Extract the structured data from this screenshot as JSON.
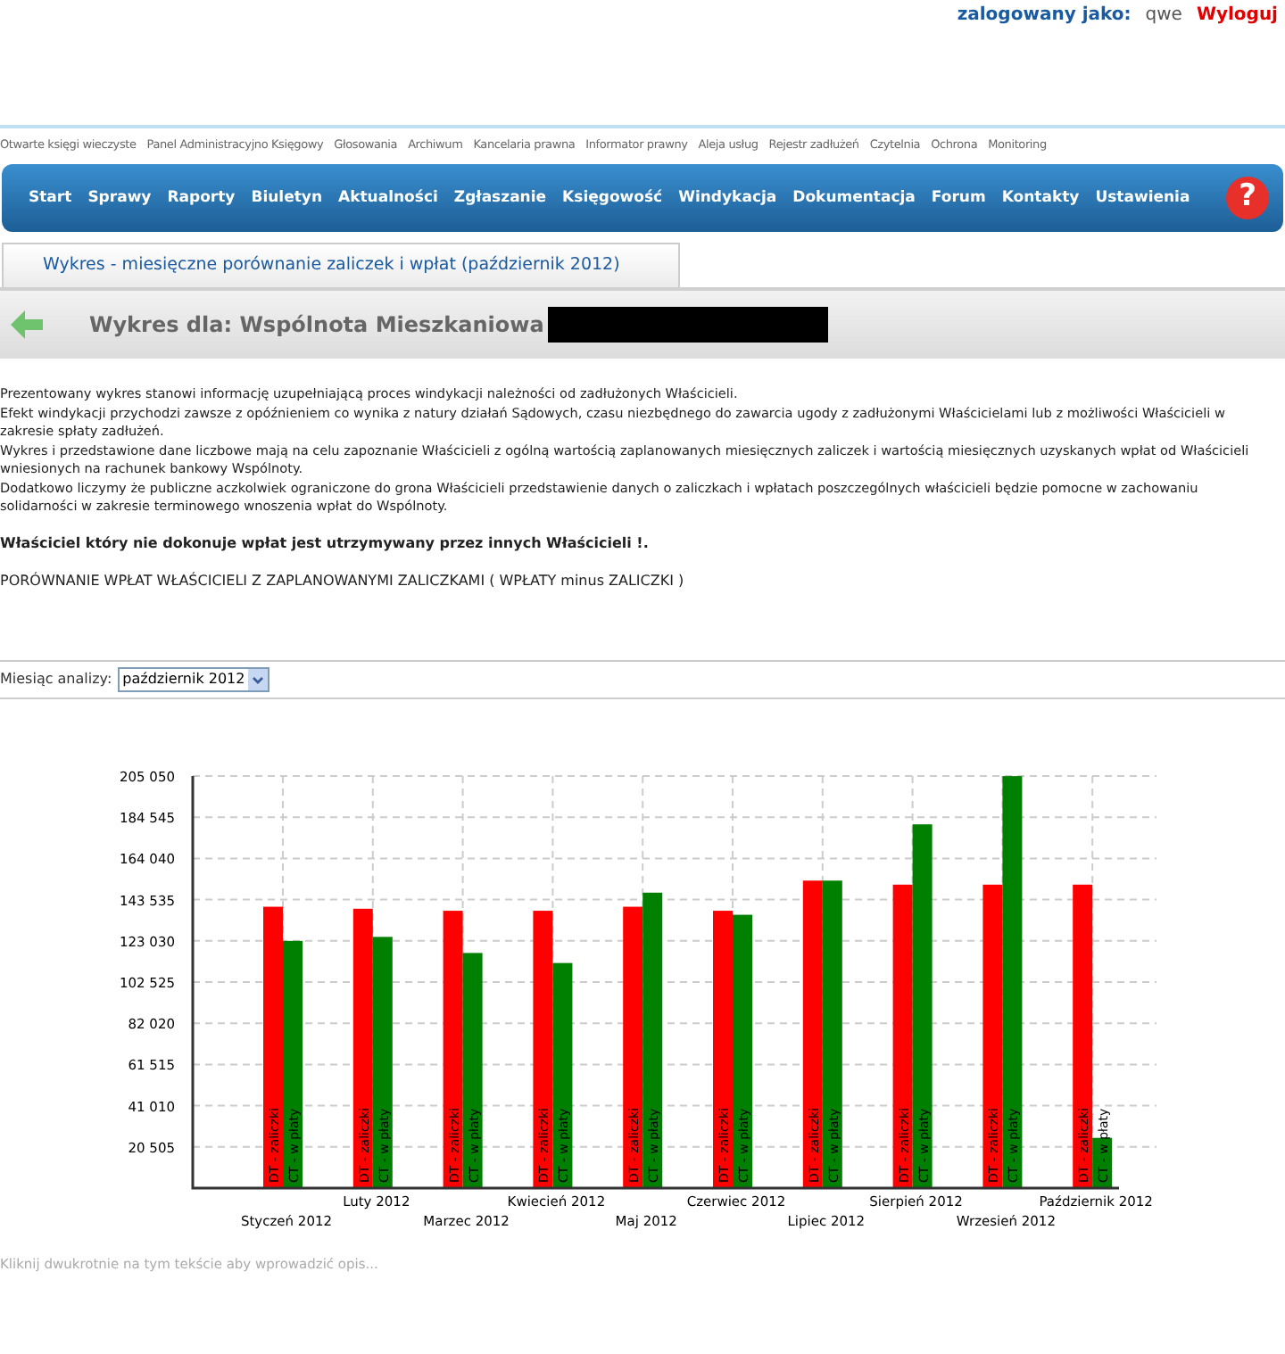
{
  "user_bar": {
    "label": "zalogowany jako:",
    "user": "qwe",
    "logout": "Wyloguj"
  },
  "top_links": [
    "Otwarte księgi wieczyste",
    "Panel Administracyjno Księgowy",
    "Głosowania",
    "Archiwum",
    "Kancelaria prawna",
    "Informator prawny",
    "Aleja usług",
    "Rejestr zadłużeń",
    "Czytelnia",
    "Ochrona",
    "Monitoring"
  ],
  "nav": [
    "Start",
    "Sprawy",
    "Raporty",
    "Biuletyn",
    "Aktualności",
    "Zgłaszanie",
    "Księgowość",
    "Windykacja",
    "Dokumentacja",
    "Forum",
    "Kontakty",
    "Ustawienia"
  ],
  "help_button": "?",
  "tab": {
    "label": "Wykres - miesięczne porównanie zaliczek i wpłat (październik 2012)",
    "selected": true
  },
  "header": {
    "title": "Wykres dla: Wspólnota Mieszkaniowa",
    "redacted": true
  },
  "intro": [
    "Prezentowany wykres stanowi informację uzupełniającą proces windykacji należności od zadłużonych Właścicieli.",
    "Efekt windykacji przychodzi zawsze z opóźnieniem co wynika z natury działań Sądowych, czasu niezbędnego do zawarcia ugody z zadłużonymi Właścicielami lub z możliwości Właścicieli w zakresie spłaty zadłużeń.",
    "Wykres i przedstawione dane liczbowe mają na celu zapoznanie Właścicieli z ogólną wartością zaplanowanych miesięcznych zaliczek i wartością miesięcznych uzyskanych wpłat od Właścicieli wniesionych na rachunek bankowy Wspólnoty.",
    "Dodatkowo liczymy że publiczne aczkolwiek ograniczone do grona Właścicieli przedstawienie danych o zaliczkach i wpłatach poszczególnych właścicieli będzie pomocne w zachowaniu solidarności w zakresie terminowego wnoszenia wpłat do Wspólnoty."
  ],
  "warning": "Właściciel który nie dokonuje wpłat jest utrzymywany przez innych Właścicieli !.",
  "section_title": "PORÓWNANIE WPŁAT WŁAŚCICIELI Z ZAPLANOWANYMI ZALICZKAMI ( WPŁATY minus ZALICZKI )",
  "month_select": {
    "label": "Miesiąc analizy:",
    "value": "październik 2012"
  },
  "chart_data": {
    "type": "bar",
    "categories": [
      "Styczeń 2012",
      "Luty 2012",
      "Marzec 2012",
      "Kwiecień 2012",
      "Maj 2012",
      "Czerwiec 2012",
      "Lipiec 2012",
      "Sierpień 2012",
      "Wrzesień 2012",
      "Październik 2012"
    ],
    "series": [
      {
        "name": "DT - zaliczki",
        "color": "#ff0000",
        "values": [
          140000,
          139000,
          138000,
          138000,
          140000,
          138000,
          153000,
          151000,
          151000,
          151000
        ]
      },
      {
        "name": "CT - w płaty",
        "color": "#008000",
        "values": [
          123000,
          125000,
          117000,
          112000,
          147000,
          136000,
          153000,
          181000,
          205000,
          25000
        ]
      }
    ],
    "ylim": [
      0,
      205050
    ],
    "yticks": [
      {
        "value": 20505,
        "label": "20 505"
      },
      {
        "value": 41010,
        "label": "41 010"
      },
      {
        "value": 61515,
        "label": "61 515"
      },
      {
        "value": 82020,
        "label": "82 020"
      },
      {
        "value": 102525,
        "label": "102 525"
      },
      {
        "value": 123030,
        "label": "123 030"
      },
      {
        "value": 143535,
        "label": "143 535"
      },
      {
        "value": 164040,
        "label": "164 040"
      },
      {
        "value": 184545,
        "label": "184 545"
      },
      {
        "value": 205050,
        "label": "205 050"
      }
    ],
    "grid": true
  },
  "description_hint": "Kliknij dwukrotnie na tym tekście aby wprowadzić opis..."
}
